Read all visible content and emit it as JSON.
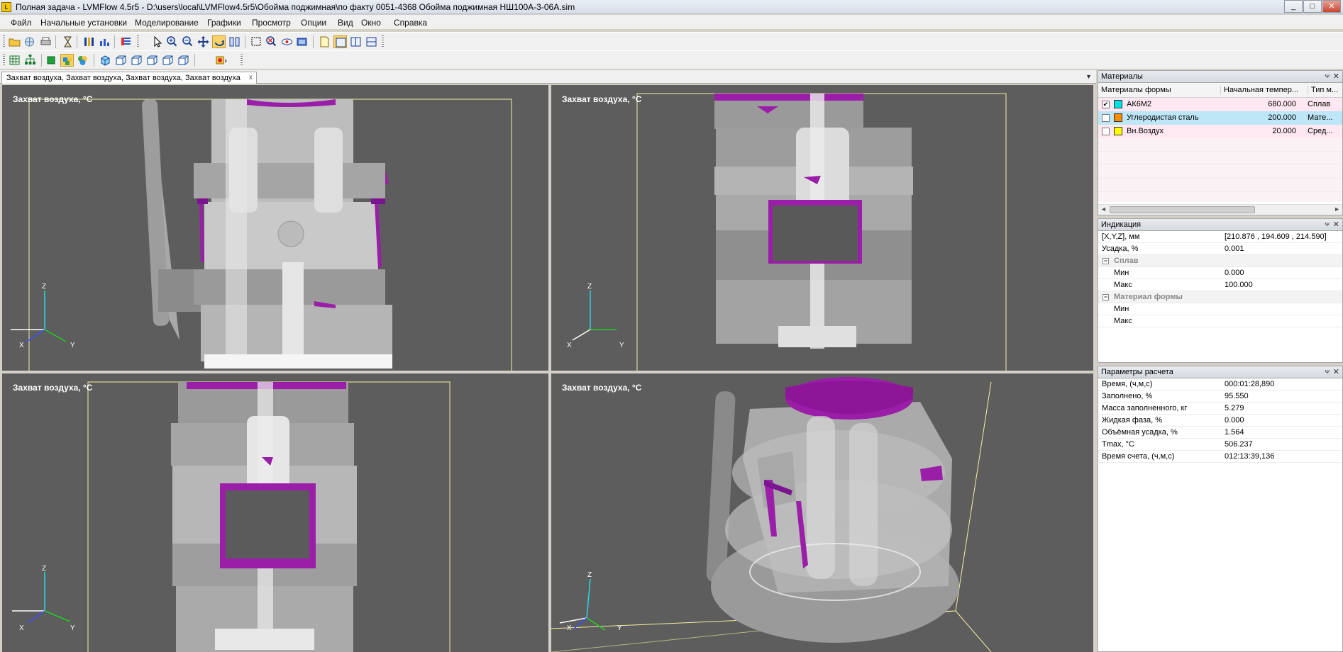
{
  "window": {
    "title": "Полная задача - LVMFlow 4.5r5 - D:\\users\\local\\LVMFlow4.5r5\\Обойма поджимная\\по факту 0051-4368 Обойма поджимная НШ100А-3-06А.sim",
    "minimize": "_",
    "maximize": "□",
    "close": "✕"
  },
  "menu": [
    "Файл",
    "Начальные установки",
    "Моделирование",
    "Графики",
    "Просмотр",
    "Опции",
    "Вид",
    "Окно",
    "Справка"
  ],
  "document_tab": {
    "label": "Захват воздуха, Захват воздуха, Захват воздуха, Захват воздуха",
    "close": "x",
    "dropdown": "▼"
  },
  "viewports": [
    {
      "label": "Захват воздуха, °C",
      "axes": {
        "z": "Z",
        "x": "X",
        "y": "Y"
      }
    },
    {
      "label": "Захват воздуха, °C",
      "axes": {
        "z": "Z",
        "x": "X",
        "y": "Y"
      }
    },
    {
      "label": "Захват воздуха, °C",
      "axes": {
        "z": "Z",
        "x": "X",
        "y": "Y"
      }
    },
    {
      "label": "Захват воздуха, °C",
      "axes": {
        "z": "Z",
        "x": "X",
        "y": "Y"
      }
    }
  ],
  "colors": {
    "casting_gray": "#d9d9d9",
    "air_capture": "#9a1ea8",
    "viewport_bg": "#5d5d5d",
    "bbox_line": "#f4f0a0"
  },
  "materials_panel": {
    "title": "Материалы",
    "pin": "ᴪ",
    "close": "✕",
    "columns": [
      "Материалы формы",
      "Начальная темпер...",
      "Тип м..."
    ],
    "rows": [
      {
        "checked": "✔",
        "color": "#00e0e0",
        "name": "АК6М2",
        "temp": "680.000",
        "type": "Сплав",
        "bg": "#ffe8f2"
      },
      {
        "checked": "",
        "color": "#ff8c00",
        "name": "Углеродистая сталь",
        "temp": "200.000",
        "type": "Мате...",
        "bg": "#bde6f6"
      },
      {
        "checked": "",
        "color": "#ffff00",
        "name": "Вн.Воздух",
        "temp": "20.000",
        "type": "Сред...",
        "bg": "#ffe8f2"
      }
    ],
    "scroll_left": "◄",
    "scroll_right": "►"
  },
  "indication_panel": {
    "title": "Индикация",
    "pin": "ᴪ",
    "close": "✕",
    "rows": [
      {
        "k": "[X,Y,Z], мм",
        "v": "[210.876 , 194.609 , 214.590]"
      },
      {
        "k": "Усадка, %",
        "v": "0.001"
      }
    ],
    "group_alloy": "Сплав",
    "alloy_rows": [
      {
        "k": "Мин",
        "v": "0.000"
      },
      {
        "k": "Макс",
        "v": "100.000"
      }
    ],
    "group_mold": "Материал формы",
    "mold_rows": [
      {
        "k": "Мин",
        "v": ""
      },
      {
        "k": "Макс",
        "v": ""
      }
    ],
    "minus": "−"
  },
  "params_panel": {
    "title": "Параметры расчета",
    "pin": "ᴪ",
    "close": "✕",
    "rows": [
      {
        "k": "Время, (ч,м,с)",
        "v": "000:01:28,890"
      },
      {
        "k": "Заполнено, %",
        "v": "95.550"
      },
      {
        "k": "Масса заполненного, кг",
        "v": "5.279"
      },
      {
        "k": "Жидкая фаза, %",
        "v": "0.000"
      },
      {
        "k": "Объёмная усадка, %",
        "v": "1.564"
      },
      {
        "k": "Tmax, °C",
        "v": "506.237"
      },
      {
        "k": "Время счета, (ч,м,с)",
        "v": "012:13:39,136"
      }
    ]
  },
  "toolbar1_icons": [
    "open-folder-icon",
    "globe-icon",
    "print-icon",
    "hourglass-icon",
    "bars-chart-icon",
    "bar-chart-icon",
    "list-icon",
    "arrow-pointer-icon",
    "zoom-in-icon",
    "zoom-out-icon",
    "move-icon",
    "rotate-icon",
    "book-icon",
    "select-rect-icon",
    "zoom-cancel-icon",
    "eye-rotate-icon",
    "frame-icon",
    "page-icon",
    "single-view-icon",
    "two-view-icon",
    "split-view-icon"
  ],
  "toolbar2_icons": [
    "grid-icon",
    "tree-icon",
    "green-square-icon",
    "palette-icon",
    "colors-icon",
    "cube-front-icon",
    "cube-side-icon",
    "cube-top-icon",
    "cube-back-icon",
    "cube-iso-icon",
    "cube-other-icon",
    "record-icon"
  ]
}
